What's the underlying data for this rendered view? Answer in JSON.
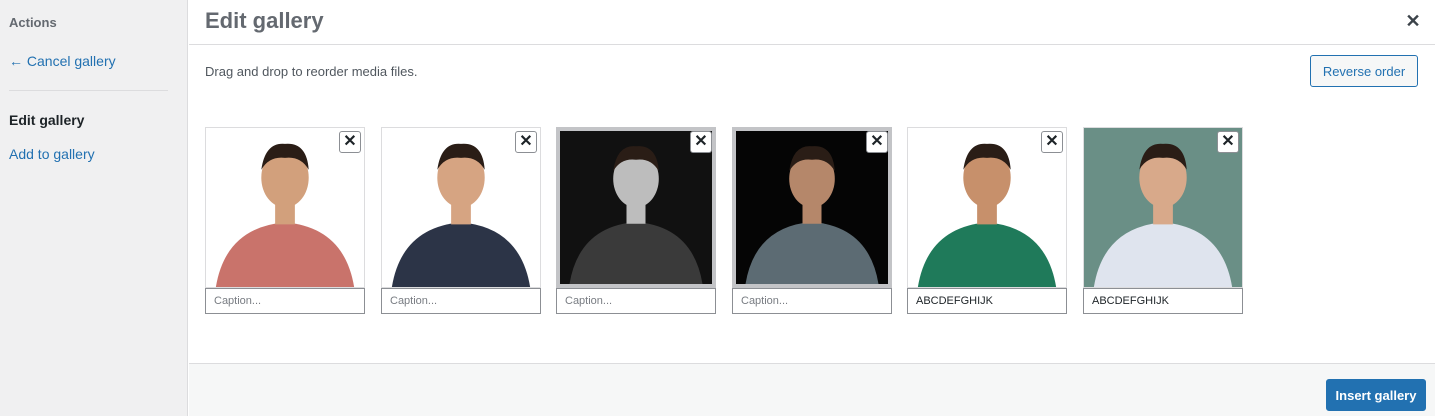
{
  "sidebar": {
    "heading": "Actions",
    "cancel_link": "← Cancel gallery",
    "current": "Edit gallery",
    "add_link": "Add to gallery"
  },
  "header": {
    "title": "Edit gallery",
    "close_icon": "close-icon"
  },
  "main": {
    "instructions": "Drag and drop to reorder media files.",
    "reverse_label": "Reverse order",
    "caption_placeholder": "Caption...",
    "items": [
      {
        "caption": "",
        "bg": "#ffffff",
        "shirt": "#c9736b",
        "skin": "#d2a07c"
      },
      {
        "caption": "",
        "bg": "#ffffff",
        "shirt": "#2c3447",
        "skin": "#d6a482"
      },
      {
        "caption": "",
        "bg": "#111111",
        "shirt": "#3a3a3a",
        "skin": "#bdbdbd"
      },
      {
        "caption": "",
        "bg": "#050505",
        "shirt": "#5c6b73",
        "skin": "#b5876a"
      },
      {
        "caption": "ABCDEFGHIJK",
        "bg": "#ffffff",
        "shirt": "#1f7a5a",
        "skin": "#c7906b"
      },
      {
        "caption": "ABCDEFGHIJK",
        "bg": "#6a8f86",
        "shirt": "#dfe4ee",
        "skin": "#d8a98a"
      }
    ]
  },
  "footer": {
    "insert_label": "Insert gallery"
  },
  "colors": {
    "accent": "#2271b1",
    "sidebar_bg": "#f0f0f1"
  }
}
